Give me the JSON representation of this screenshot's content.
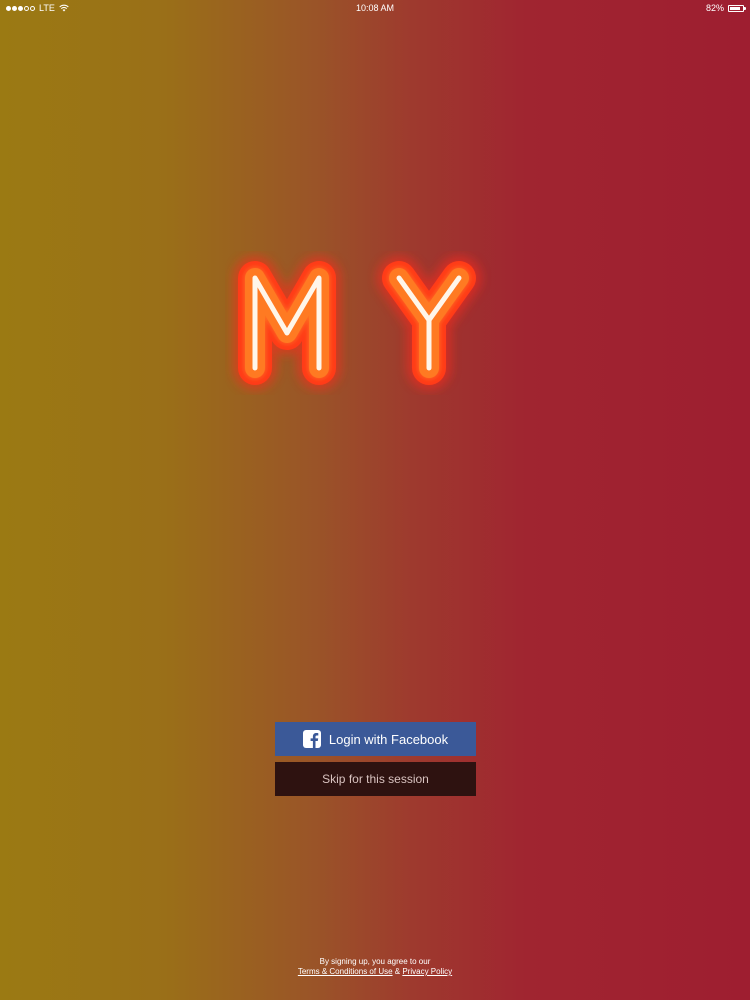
{
  "status_bar": {
    "carrier": "LTE",
    "time": "10:08 AM",
    "battery_percent": "82%",
    "battery_level": 0.82,
    "signal_bars_filled": 3,
    "signal_bars_total": 5
  },
  "logo": {
    "text": "MY",
    "glow_color": "#ff4a1a",
    "stroke_color": "#fff6ea"
  },
  "buttons": {
    "facebook_label": "Login with Facebook",
    "skip_label": "Skip for this session"
  },
  "legal": {
    "intro": "By signing up, you agree to our",
    "terms_link": "Terms & Conditions of Use",
    "separator": "&",
    "privacy_link": "Privacy Policy"
  },
  "colors": {
    "facebook_blue": "#3b5998",
    "skip_background": "#2e1210",
    "gradient_left": "#9b7a13",
    "gradient_right": "#9e1e30"
  }
}
